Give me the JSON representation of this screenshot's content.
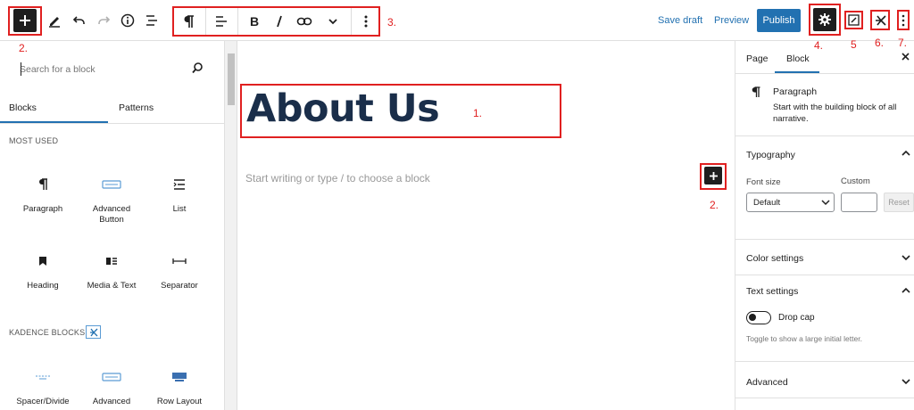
{
  "toolbar": {
    "save_draft": "Save draft",
    "preview": "Preview",
    "publish": "Publish",
    "brand_color": "#2271b1",
    "annotation_color": "#e02020"
  },
  "annotations": {
    "a1": "1.",
    "a2_top": "2.",
    "a2_right": "2.",
    "a3": "3.",
    "a4": "4.",
    "a5": "5",
    "a6": "6.",
    "a7": "7."
  },
  "inserter": {
    "search_placeholder": "Search for a block",
    "tabs": [
      "Blocks",
      "Patterns"
    ],
    "most_used_heading": "MOST USED",
    "kadence_heading": "KADENCE BLOCKS",
    "most_used": [
      {
        "label": "Paragraph",
        "icon": "paragraph-icon"
      },
      {
        "label": "Advanced Button",
        "icon": "button-icon"
      },
      {
        "label": "List",
        "icon": "list-icon"
      },
      {
        "label": "Heading",
        "icon": "bookmark-icon"
      },
      {
        "label": "Media & Text",
        "icon": "media-text-icon"
      },
      {
        "label": "Separator",
        "icon": "separator-icon"
      }
    ],
    "kadence": [
      {
        "label": "Spacer/Divide",
        "icon": "spacer-icon"
      },
      {
        "label": "Advanced Button",
        "icon": "button-icon"
      },
      {
        "label": "Row Layout",
        "icon": "row-layout-icon"
      }
    ]
  },
  "editor": {
    "title": "About Us",
    "placeholder": "Start writing or type / to choose a block"
  },
  "sidebar": {
    "tabs": [
      "Page",
      "Block"
    ],
    "block_name": "Paragraph",
    "block_description": "Start with the building block of all narrative.",
    "typography_title": "Typography",
    "font_size_label": "Font size",
    "custom_label": "Custom",
    "font_size_value": "Default",
    "reset_label": "Reset",
    "color_settings": "Color settings",
    "text_settings": "Text settings",
    "drop_cap_label": "Drop cap",
    "drop_cap_help": "Toggle to show a large initial letter.",
    "advanced": "Advanced"
  }
}
